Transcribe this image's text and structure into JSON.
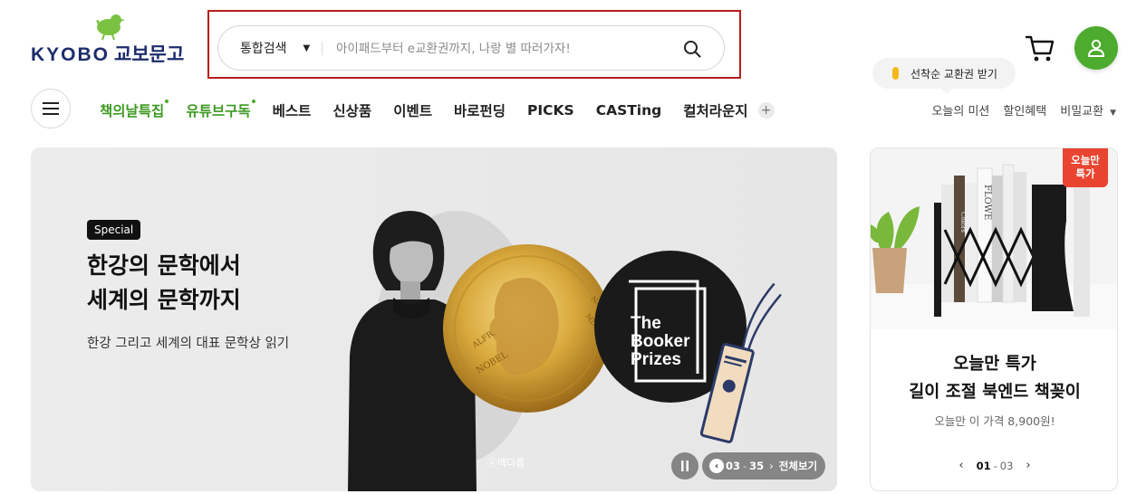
{
  "header": {
    "logo_text": "KYOBO",
    "logo_korean": "교보문고",
    "search": {
      "category": "통합검색",
      "placeholder": "아이패드부터 e교환권까지, 나랑 별 따러가자!"
    },
    "coupon_bubble": "선착순 교환권 받기"
  },
  "nav": {
    "items": [
      {
        "label": "책의날특집",
        "highlight": true,
        "dot": true
      },
      {
        "label": "유튜브구독",
        "highlight": true,
        "dot": true
      },
      {
        "label": "베스트"
      },
      {
        "label": "신상품"
      },
      {
        "label": "이벤트"
      },
      {
        "label": "바로펀딩"
      },
      {
        "label": "PICKS"
      },
      {
        "label": "CASTing"
      },
      {
        "label": "컬처라운지"
      }
    ],
    "more_label": "+",
    "util_links": [
      "오늘의 미션",
      "할인혜택",
      "비밀교환"
    ]
  },
  "banner": {
    "badge": "Special",
    "title_line1": "한강의 문학에서",
    "title_line2": "세계의 문학까지",
    "subtitle": "한강 그리고 세계의 대표 문학상 읽기",
    "photo_credit": "ⓒ백다흠",
    "medal_text_left": "ALFR. NOBEL",
    "medal_text_right": "NAT. MDCCC XXXIII OB. MDCCC XCVI",
    "booker_logo": [
      "The",
      "Booker",
      "Prizes"
    ],
    "pager": {
      "current": "03",
      "total": "35",
      "view_all": "전체보기"
    }
  },
  "side_card": {
    "badge_line1": "오늘만",
    "badge_line2": "특가",
    "book_spines": [
      "FLOWE",
      "Colors"
    ],
    "title_line1": "오늘만 특가",
    "title_line2": "길이 조절 북엔드 책꽂이",
    "price_text": "오늘만 이 가격 8,900원!",
    "pager": {
      "current": "01",
      "total": "03"
    }
  },
  "colors": {
    "brand_green": "#4dab2d",
    "logo_navy": "#1c2c6c",
    "highlight_red": "#b71c1c",
    "badge_red": "#e8442f"
  }
}
